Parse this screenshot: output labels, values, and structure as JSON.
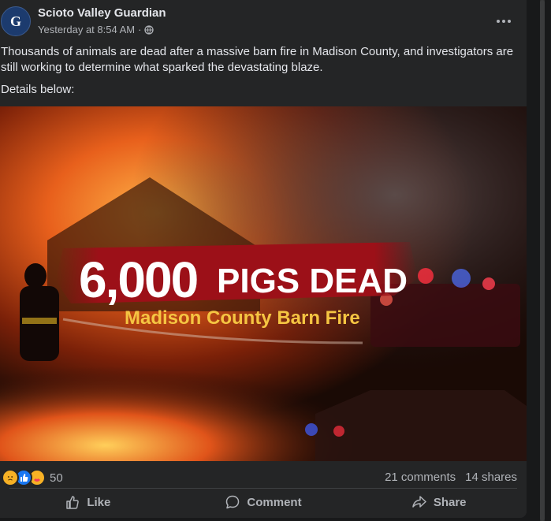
{
  "post": {
    "page_name": "Scioto Valley Guardian",
    "timestamp": "Yesterday at 8:54 AM",
    "separator": "·",
    "audience_icon": "globe-icon",
    "more_icon": "more-horizontal-icon",
    "avatar_letter": "G",
    "text_p1": "Thousands of animals are dead after a massive barn fire in Madison County, and investigators are still working to determine what sparked the devastating blaze.",
    "text_p2": "Details below:"
  },
  "image": {
    "headline_number": "6,000",
    "headline_words": "PIGS DEAD",
    "subheadline": "Madison County Barn Fire"
  },
  "stats": {
    "reactions": [
      "sad",
      "like",
      "care"
    ],
    "reaction_count": "50",
    "comments": "21 comments",
    "shares": "14 shares"
  },
  "actions": {
    "like": "Like",
    "comment": "Comment",
    "share": "Share"
  },
  "colors": {
    "card_bg": "#242526",
    "text": "#e4e6eb",
    "secondary": "#b0b3b8",
    "headline_banner": "#a0121c",
    "subheadline": "#f5c542"
  }
}
